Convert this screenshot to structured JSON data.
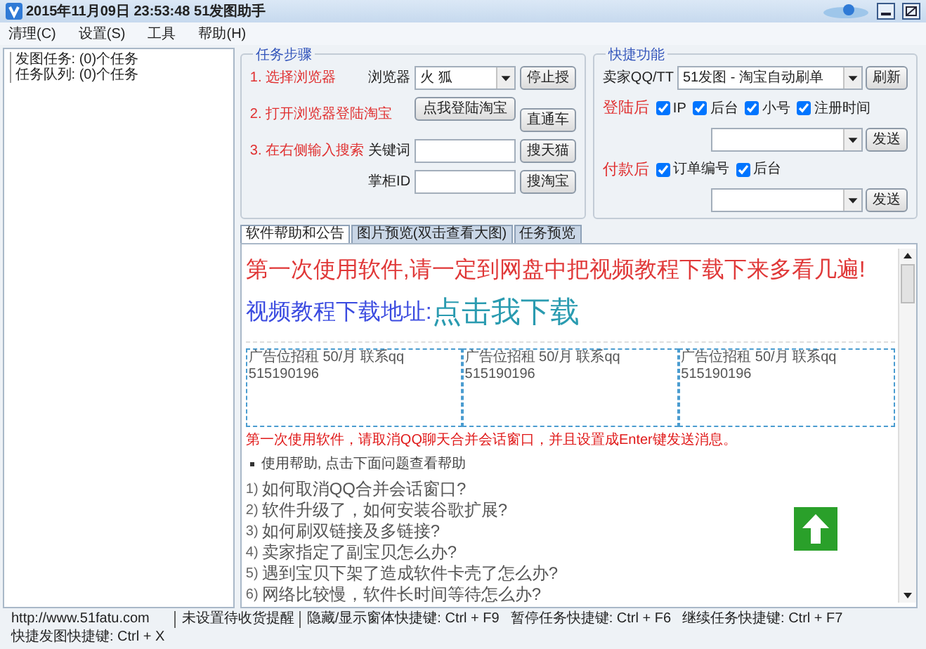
{
  "window": {
    "title": "2015年11月09日 23:53:48 51发图助手"
  },
  "menu": [
    {
      "label": "清理(C)"
    },
    {
      "label": "设置(S)"
    },
    {
      "label": "工具"
    },
    {
      "label": "帮助(H)"
    }
  ],
  "tree": [
    {
      "label": "发图任务: (0)个任务"
    },
    {
      "label": "任务队列: (0)个任务"
    }
  ],
  "task_steps": {
    "title": "任务步骤",
    "step_1": {
      "label": "1. 选择浏览器",
      "field_label": "浏览器",
      "select_value": "火 狐",
      "button": "停止授"
    },
    "step_2": {
      "label": "2. 打开浏览器登陆淘宝",
      "button": "点我登陆淘宝",
      "side_button": "直通车"
    },
    "step_3": {
      "label": "3. 在右侧输入搜索",
      "keyword_label": "关键词",
      "keyword_button": "搜天猫",
      "shop_label": "掌柜ID",
      "shop_button": "搜淘宝"
    }
  },
  "quick_functions": {
    "title": "快捷功能",
    "seller_label": "卖家QQ/TT",
    "seller_select": "51发图 - 淘宝自动刷单",
    "refresh_button": "刷新",
    "login_after": {
      "label": "登陆后",
      "options": [
        {
          "label": "IP",
          "checked": true
        },
        {
          "label": "后台",
          "checked": true
        },
        {
          "label": "小号",
          "checked": true
        },
        {
          "label": "注册时间",
          "checked": true
        }
      ],
      "button": "发送"
    },
    "pay_after": {
      "label": "付款后",
      "options": [
        {
          "label": "订单编号",
          "checked": true
        },
        {
          "label": "后台",
          "checked": true
        }
      ],
      "button": "发送"
    }
  },
  "tabs": [
    {
      "label": "软件帮助和公告",
      "selected": true
    },
    {
      "label": "图片预览(双击查看大图)",
      "selected": false
    },
    {
      "label": "任务预览",
      "selected": false
    }
  ],
  "help": {
    "notice": "第一次使用软件,请一定到网盘中把视频教程下载下来多看几遍!",
    "download_label": "视频教程下载地址:",
    "download_link": "点击我下载",
    "ads": [
      "广告位招租 50/月 联系qq 515190196",
      "广告位招租 50/月 联系qq 515190196",
      "广告位招租 50/月 联系qq 515190196"
    ],
    "warning": "第一次使用软件，请取消QQ聊天合并会话窗口，并且设置成Enter键发送消息。",
    "help_intro": "使用帮助, 点击下面问题查看帮助",
    "faq": [
      {
        "number": "1)",
        "text": "如何取消QQ合并会话窗口?"
      },
      {
        "number": "2)",
        "text": "软件升级了，如何安装谷歌扩展?"
      },
      {
        "number": "3)",
        "text": "如何刷双链接及多链接?"
      },
      {
        "number": "4)",
        "text": "卖家指定了副宝贝怎么办?"
      },
      {
        "number": "5)",
        "text": "遇到宝贝下架了造成软件卡壳了怎么办?"
      },
      {
        "number": "6)",
        "text": "网络比较慢，软件长时间等待怎么办?"
      }
    ]
  },
  "status_bar": [
    "http://www.51fatu.com",
    "未设置待收货提醒",
    "隐藏/显示窗体快捷键: Ctrl + F9",
    "暂停任务快捷键: Ctrl + F6",
    "继续任务快捷键: Ctrl + F7",
    "快捷发图快捷键: Ctrl + X"
  ]
}
